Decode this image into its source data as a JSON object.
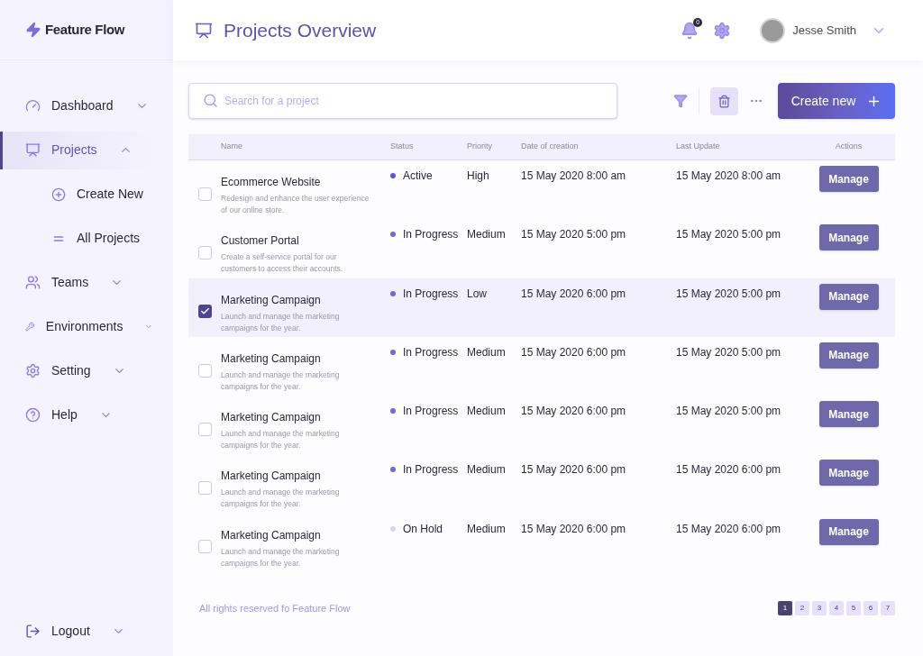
{
  "brand": "Feature Flow",
  "nav": [
    {
      "label": "Dashboard",
      "selected": false,
      "expanded": false
    },
    {
      "label": "Projects",
      "selected": true,
      "expanded": true,
      "children": [
        {
          "label": "Create New"
        },
        {
          "label": "All Projects"
        }
      ]
    },
    {
      "label": "Teams",
      "selected": false,
      "expanded": false
    },
    {
      "label": "Environments",
      "selected": false,
      "expanded": false
    },
    {
      "label": "Setting",
      "selected": false,
      "expanded": false
    },
    {
      "label": "Help",
      "selected": false,
      "expanded": false
    }
  ],
  "logout": "Logout",
  "page_title": "Projects Overview",
  "notification_count": "0",
  "user": {
    "name": "Jesse Smith"
  },
  "search": {
    "placeholder": "Search for a project"
  },
  "create_button": "Create new",
  "table": {
    "columns": [
      "Name",
      "Status",
      "Priority",
      "Date of creation",
      "Last Update",
      "Actions"
    ],
    "rows": [
      {
        "name": "Ecommerce Website",
        "description": "Redesign and enhance the user experience of our online store.",
        "status": "Active",
        "color": "#5b55d6",
        "priority": "High",
        "created": "15 May 2020 8:00 am",
        "updated": "15 May 2020 8:00 am",
        "action": "Manage",
        "checked": false,
        "selected": false
      },
      {
        "name": "Customer Portal",
        "description": "Create a self-service portal for our customers to access their accounts.",
        "status": "In Progress",
        "color": "#6f6ad8",
        "priority": "Medium",
        "created": "15 May 2020 5:00 pm",
        "updated": "15 May 2020 5:00 pm",
        "action": "Manage",
        "checked": false,
        "selected": false
      },
      {
        "name": "Marketing Campaign",
        "description": "Launch and manage the marketing campaigns for the year.",
        "status": "In Progress",
        "color": "#6f6ad8",
        "priority": "Low",
        "created": "15 May 2020 6:00 pm",
        "updated": "15 May 2020 5:00 pm",
        "action": "Manage",
        "checked": true,
        "selected": true
      },
      {
        "name": "Marketing Campaign",
        "description": "Launch and manage the marketing campaigns for the year.",
        "status": "In Progress",
        "color": "#6f6ad8",
        "priority": "Medium",
        "created": "15 May 2020 6:00 pm",
        "updated": "15 May 2020 5:00 pm",
        "action": "Manage",
        "checked": false,
        "selected": false
      },
      {
        "name": "Marketing Campaign",
        "description": "Launch and manage the marketing campaigns for the year.",
        "status": "In Progress",
        "color": "#6f6ad8",
        "priority": "Medium",
        "created": "15 May 2020 6:00 pm",
        "updated": "15 May 2020 5:00 pm",
        "action": "Manage",
        "checked": false,
        "selected": false
      },
      {
        "name": "Marketing Campaign",
        "description": "Launch and manage the marketing campaigns for the year.",
        "status": "In Progress",
        "color": "#6f6ad8",
        "priority": "Medium",
        "created": "15 May 2020 6:00 pm",
        "updated": "15 May 2020 6:00 pm",
        "action": "Manage",
        "checked": false,
        "selected": false
      },
      {
        "name": "Marketing Campaign",
        "description": "Launch and manage the marketing campaigns for the year.",
        "status": "On Hold",
        "color": "#d9d2f7",
        "priority": "Medium",
        "created": "15 May 2020 6:00 pm",
        "updated": "15 May 2020 6:00 pm",
        "action": "Manage",
        "checked": false,
        "selected": false
      }
    ]
  },
  "footer": "All rights reserved fo Feature Flow",
  "pages": [
    {
      "label": "1",
      "selected": true
    },
    {
      "label": "2",
      "selected": false
    },
    {
      "label": "3",
      "selected": false
    },
    {
      "label": "4",
      "selected": false
    },
    {
      "label": "5",
      "selected": false
    },
    {
      "label": "6",
      "selected": false
    },
    {
      "label": "7",
      "selected": false
    }
  ]
}
